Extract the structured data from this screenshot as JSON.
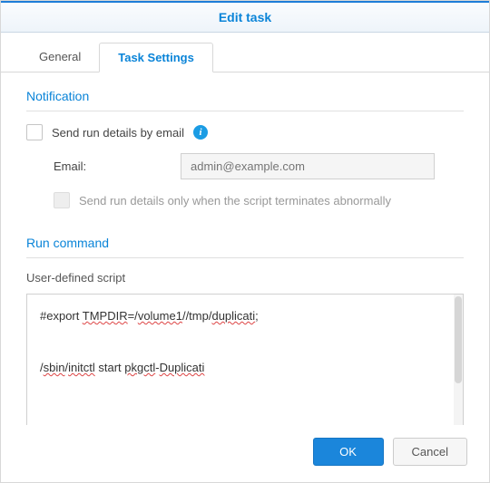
{
  "dialog": {
    "title": "Edit task"
  },
  "tabs": {
    "general": "General",
    "task_settings": "Task Settings"
  },
  "notification": {
    "title": "Notification",
    "send_details_label": "Send run details by email",
    "email_label": "Email:",
    "email_placeholder": "admin@example.com",
    "abnormal_label": "Send run details only when the script terminates abnormally"
  },
  "run_command": {
    "title": "Run command",
    "user_script_label": "User-defined script",
    "script_line1_prefix": "#export ",
    "script_line1_var": "TMPDIR",
    "script_line1_mid": "=/",
    "script_line1_vol": "volume1",
    "script_line1_tmp": "//tmp/",
    "script_line1_dup": "duplicati",
    "script_line1_end": ";",
    "script_line2_prefix": "/",
    "script_line2_sbin": "sbin",
    "script_line2_sl1": "/",
    "script_line2_initctl": "initctl",
    "script_line2_mid": " start ",
    "script_line2_pkg": "pkgctl",
    "script_line2_dash": "-",
    "script_line2_dup": "Duplicati"
  },
  "footer": {
    "ok": "OK",
    "cancel": "Cancel"
  }
}
